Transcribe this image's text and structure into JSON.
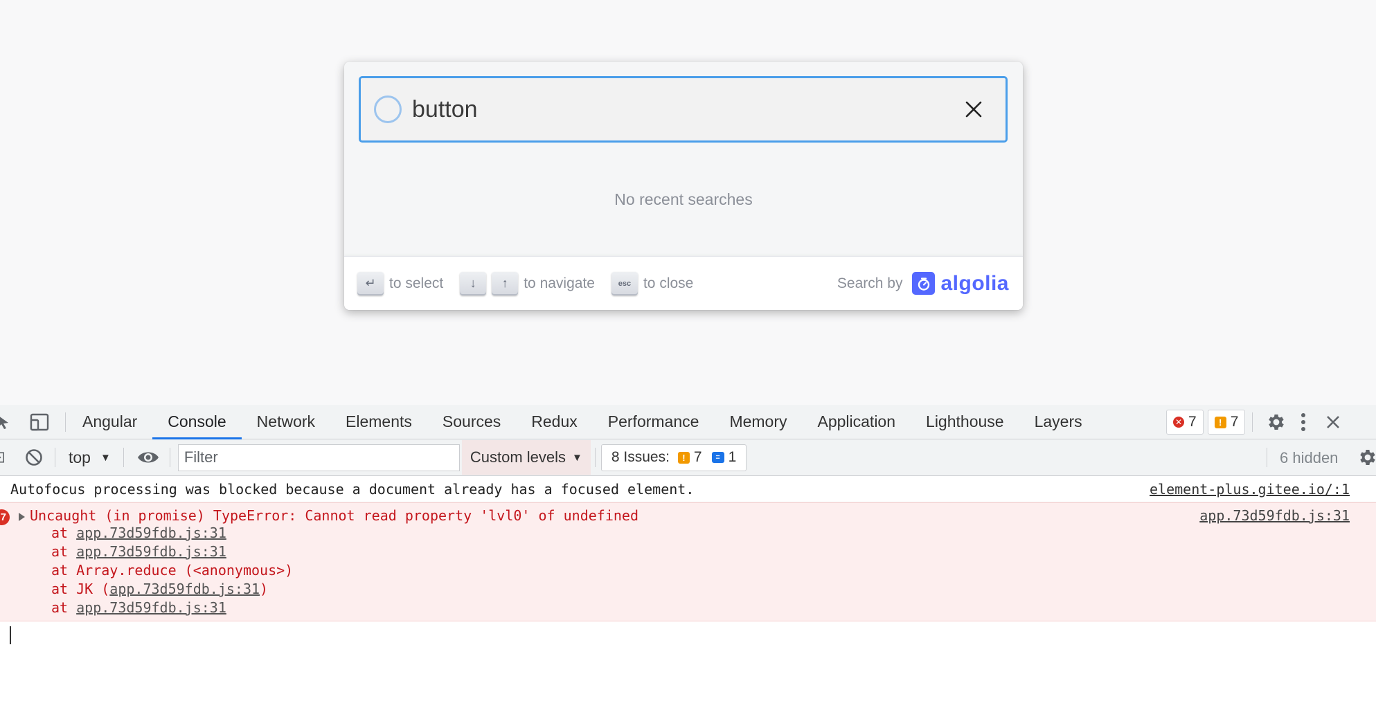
{
  "search_modal": {
    "query": "button",
    "empty_state": "No recent searches",
    "footer": {
      "select_key": "↵",
      "select_label": "to select",
      "down_key": "↓",
      "up_key": "↑",
      "navigate_label": "to navigate",
      "esc_key": "esc",
      "close_label": "to close",
      "search_by_label": "Search by",
      "brand": "algolia",
      "brand_color": "#5468ff"
    }
  },
  "devtools": {
    "tabs": [
      "Angular",
      "Console",
      "Network",
      "Elements",
      "Sources",
      "Redux",
      "Performance",
      "Memory",
      "Application",
      "Lighthouse",
      "Layers"
    ],
    "active_tab": "Console",
    "error_count": "7",
    "warning_count": "7",
    "toolbar": {
      "context": "top",
      "filter_placeholder": "Filter",
      "levels": "Custom levels",
      "issues_label": "8 Issues:",
      "issues_warn": "7",
      "issues_info": "1",
      "hidden": "6 hidden"
    },
    "console": {
      "message": {
        "text": "Autofocus processing was blocked because a document already has a focused element.",
        "source": "element-plus.gitee.io/:1"
      },
      "error": {
        "count": "7",
        "text": "Uncaught (in promise) TypeError: Cannot read property 'lvl0' of undefined",
        "source": "app.73d59fdb.js:31",
        "stack": [
          {
            "prefix": "at ",
            "link": "app.73d59fdb.js:31",
            "suffix": ""
          },
          {
            "prefix": "at ",
            "link": "app.73d59fdb.js:31",
            "suffix": ""
          },
          {
            "prefix": "at Array.reduce (<anonymous>)",
            "link": "",
            "suffix": ""
          },
          {
            "prefix": "at JK (",
            "link": "app.73d59fdb.js:31",
            "suffix": ")"
          },
          {
            "prefix": "at ",
            "link": "app.73d59fdb.js:31",
            "suffix": ""
          }
        ]
      }
    },
    "colors": {
      "accent": "#1a73e8",
      "error_text": "#c4161c",
      "error_bg": "#fdeeee"
    }
  }
}
